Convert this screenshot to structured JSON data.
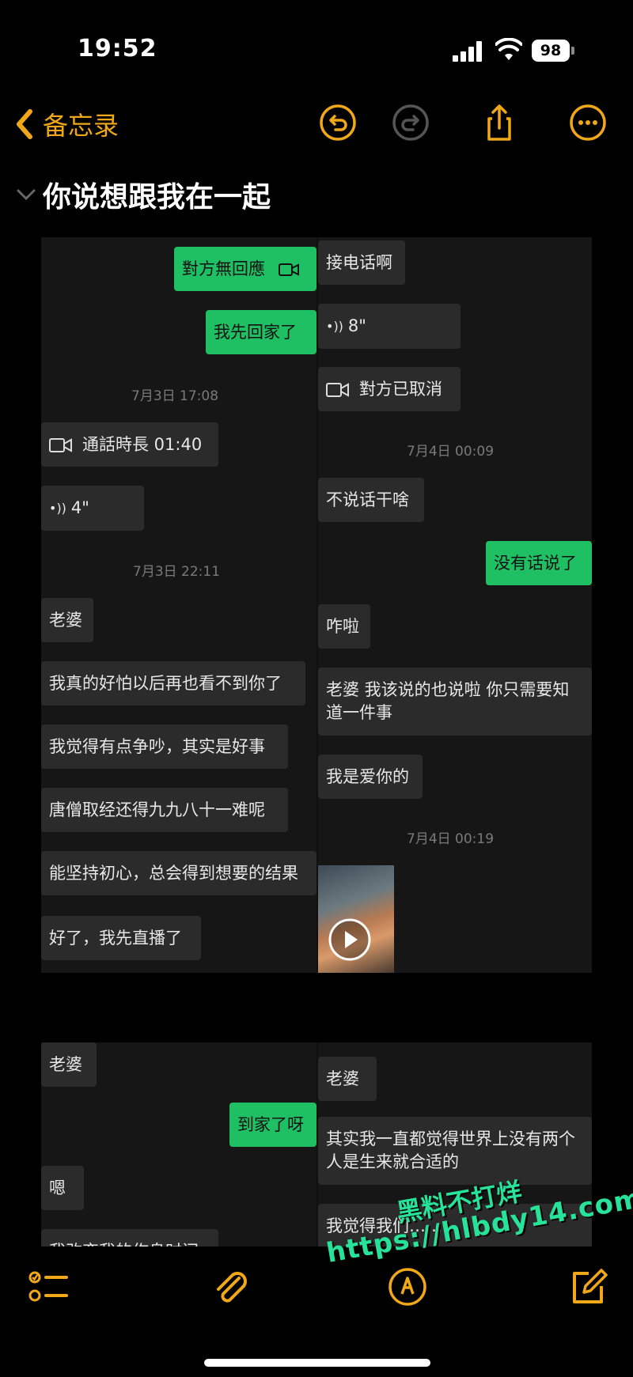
{
  "status": {
    "time": "19:52",
    "battery": "98"
  },
  "nav": {
    "back_label": "备忘录"
  },
  "note": {
    "title": "你说想跟我在一起"
  },
  "panel1": {
    "left": {
      "out1": "對方無回應",
      "out2": "我先回家了",
      "stamp1": "7月3日 17:08",
      "call": "通話時長 01:40",
      "voice": "4\"",
      "stamp2": "7月3日 22:11",
      "m1": "老婆",
      "m2": "我真的好怕以后再也看不到你了",
      "m3": "我觉得有点争吵，其实是好事",
      "m4": "唐僧取经还得九九八十一难呢",
      "m5": "能坚持初心，总会得到想要的结果",
      "m6": "好了，我先直播了"
    },
    "right": {
      "m1": "接电话啊",
      "voice": "8\"",
      "cancel": "對方已取消",
      "stamp1": "7月4日 00:09",
      "m2": "不说话干啥",
      "out1": "没有话说了",
      "m3": "咋啦",
      "m4": "老婆 我该说的也说啦 你只需要知道一件事",
      "m5": "我是爱你的",
      "stamp2": "7月4日 00:19"
    }
  },
  "panel2": {
    "left": {
      "m1": "老婆",
      "out1": "到家了呀",
      "m2": "嗯",
      "m3": "我改变我的作息时间"
    },
    "right": {
      "m1": "老婆",
      "m2": "其实我一直都觉得世界上没有两个人是生来就合适的",
      "m3": "我觉得我们……"
    }
  },
  "watermark": {
    "line1": "黑料不打烊",
    "line2": "https://hlbdy14.com"
  },
  "icons": {
    "back": "chevron-left-icon",
    "undo": "undo-icon",
    "redo": "redo-icon",
    "share": "share-icon",
    "more": "more-icon",
    "checklist": "checklist-icon",
    "attach": "paperclip-icon",
    "markup": "pen-circle-icon",
    "compose": "compose-icon"
  },
  "colors": {
    "accent": "#f0a718",
    "wechat_green": "#1fbf63"
  }
}
